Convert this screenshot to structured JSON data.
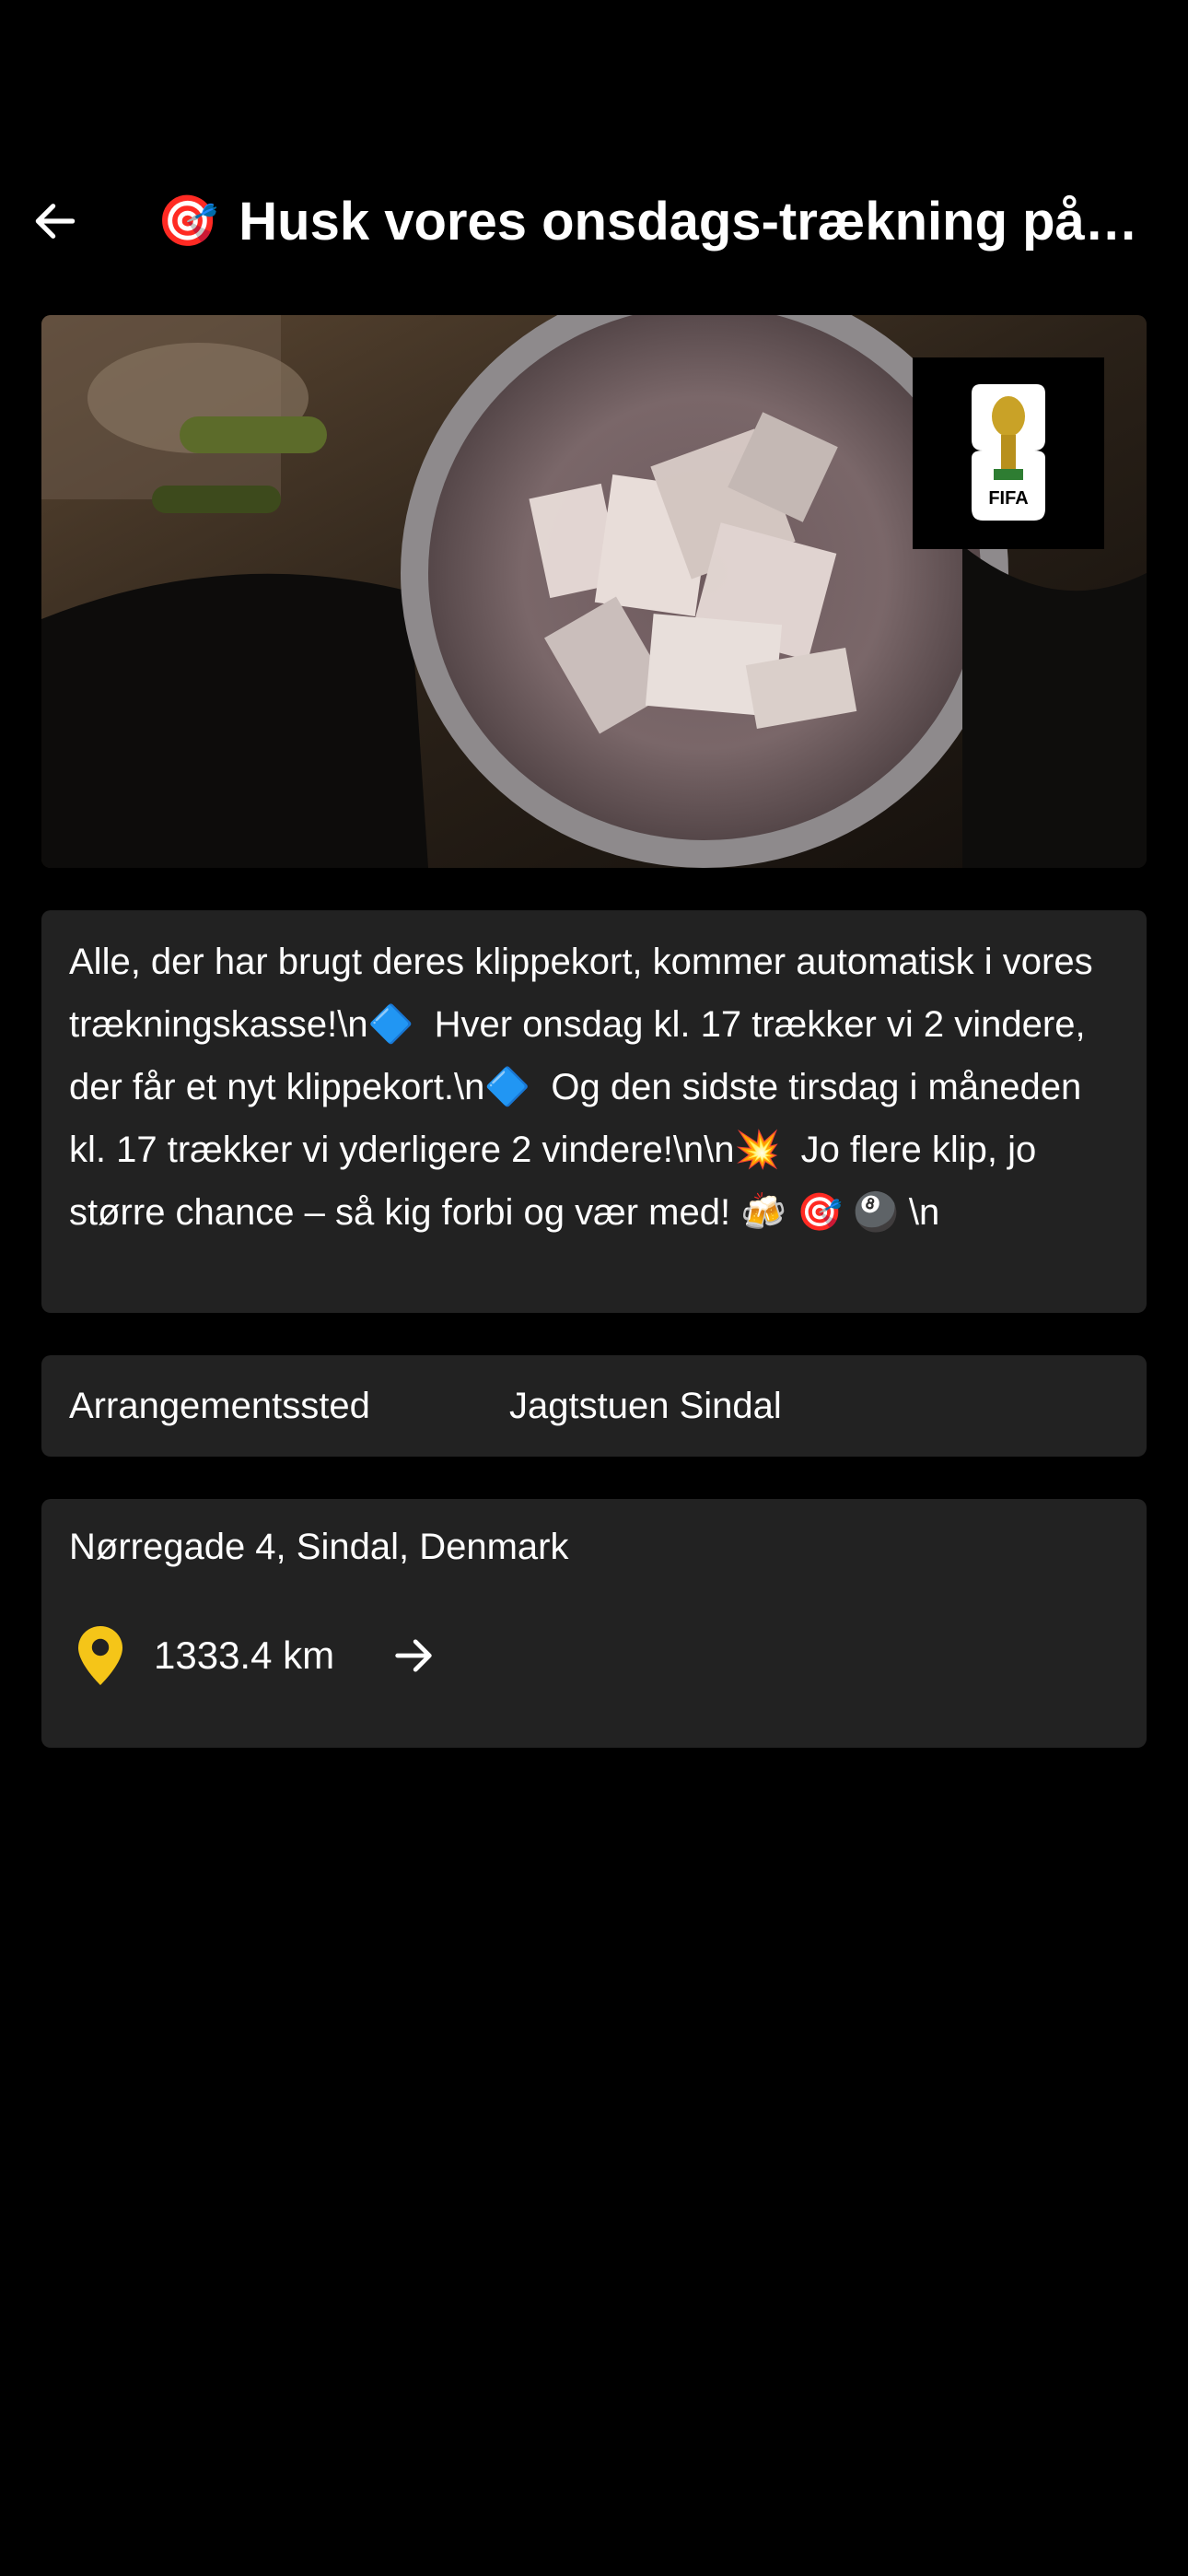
{
  "header": {
    "back_icon": "arrow-left-icon",
    "title_emoji": "🎯",
    "title": "Husk vores onsdags-trækning på klippekort!"
  },
  "hero": {
    "badge_text": "FIFA"
  },
  "description": {
    "text": "Alle, der har brugt deres klippekort, kommer automatisk i vores trækningskasse!\\n🔷  Hver onsdag kl. 17 trækker vi 2 vindere, der får et nyt klippekort.\\n🔷  Og den sidste tirsdag i måneden kl. 17 trækker vi yderligere 2 vindere!\\n\\n💥  Jo flere klip, jo større chance – så kig forbi og vær med! 🍻 🎯 🎱 \\n"
  },
  "venue": {
    "label": "Arrangementssted",
    "value": "Jagtstuen Sindal"
  },
  "address": {
    "text": "Nørregade 4, Sindal, Denmark",
    "distance": "1333.4 km",
    "pin_icon": "location-pin-icon",
    "pin_color": "#F5C518",
    "arrow_icon": "arrow-right-icon"
  },
  "colors": {
    "background": "#000000",
    "card": "#222222",
    "text": "#FFFFFF"
  }
}
